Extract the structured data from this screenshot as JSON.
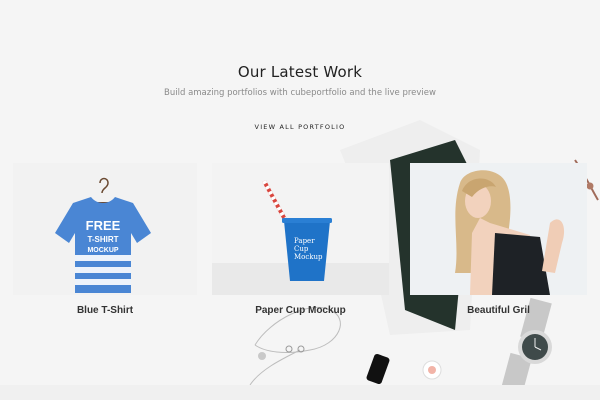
{
  "section": {
    "heading": "Our Latest Work",
    "subheading": "Build amazing portfolios with cubeportfolio and the live preview",
    "view_all_label": "VIEW ALL PORTFOLIO"
  },
  "portfolio_items": [
    {
      "title": "Blue T-Shirt",
      "image_text": [
        "FREE",
        "T-SHIRT",
        "MOCKUP"
      ]
    },
    {
      "title": "Paper Cup Mockup",
      "image_text": [
        "Paper",
        "Cup",
        "Mockup"
      ]
    },
    {
      "title": "Beautiful Gril"
    }
  ],
  "colors": {
    "background": "#f5f5f5",
    "shirt_blue": "#4a86d4",
    "cup_blue": "#1f73c8",
    "heading_text": "#222222",
    "subheading_text": "#8a8a8a"
  }
}
